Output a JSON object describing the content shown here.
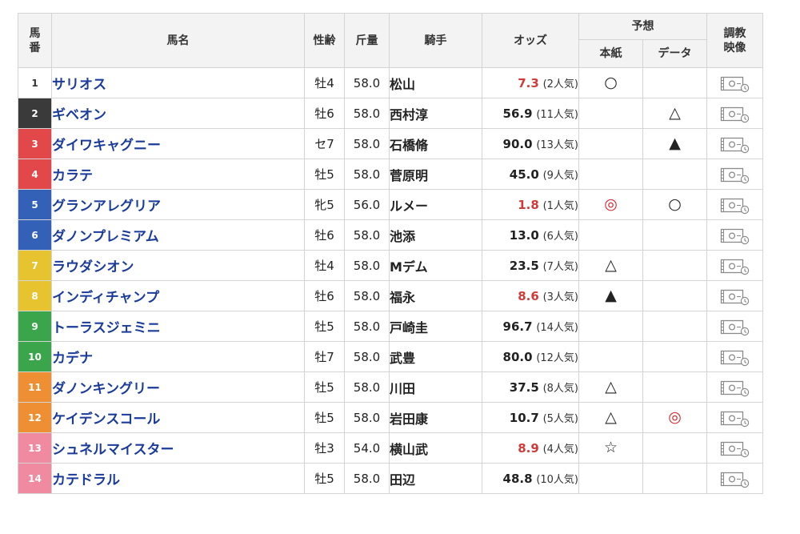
{
  "table": {
    "headers": {
      "number": "馬\n番",
      "horse_name": "馬名",
      "sex_age": "性齢",
      "weight": "斤量",
      "jockey": "騎手",
      "odds": "オッズ",
      "prediction": "予想",
      "prediction_paper": "本紙",
      "prediction_data": "データ",
      "training_video": "調教\n映像"
    },
    "rows": [
      {
        "number": "1",
        "name": "サリオス",
        "sex_age": "牡4",
        "weight": "58.0",
        "jockey": "松山",
        "odds": "7.3",
        "popularity": "(2人気)",
        "favorite": true,
        "mark_paper": "○",
        "mark_data": "",
        "frame_color": "#ffffff",
        "number_color": "#333333"
      },
      {
        "number": "2",
        "name": "ギベオン",
        "sex_age": "牡6",
        "weight": "58.0",
        "jockey": "西村淳",
        "odds": "56.9",
        "popularity": "(11人気)",
        "favorite": false,
        "mark_paper": "",
        "mark_data": "△",
        "frame_color": "#3a3a3a",
        "number_color": "#ffffff"
      },
      {
        "number": "3",
        "name": "ダイワキャグニー",
        "sex_age": "セ7",
        "weight": "58.0",
        "jockey": "石橋脩",
        "odds": "90.0",
        "popularity": "(13人気)",
        "favorite": false,
        "mark_paper": "",
        "mark_data": "▲",
        "frame_color": "#e2474a",
        "number_color": "#ffffff"
      },
      {
        "number": "4",
        "name": "カラテ",
        "sex_age": "牡5",
        "weight": "58.0",
        "jockey": "菅原明",
        "odds": "45.0",
        "popularity": "(9人気)",
        "favorite": false,
        "mark_paper": "",
        "mark_data": "",
        "frame_color": "#e2474a",
        "number_color": "#ffffff"
      },
      {
        "number": "5",
        "name": "グランアレグリア",
        "sex_age": "牝5",
        "weight": "56.0",
        "jockey": "ルメー",
        "odds": "1.8",
        "popularity": "(1人気)",
        "favorite": true,
        "mark_paper": "◎",
        "mark_data": "○",
        "frame_color": "#3461b8",
        "number_color": "#ffffff"
      },
      {
        "number": "6",
        "name": "ダノンプレミアム",
        "sex_age": "牡6",
        "weight": "58.0",
        "jockey": "池添",
        "odds": "13.0",
        "popularity": "(6人気)",
        "favorite": false,
        "mark_paper": "",
        "mark_data": "",
        "frame_color": "#3461b8",
        "number_color": "#ffffff"
      },
      {
        "number": "7",
        "name": "ラウダシオン",
        "sex_age": "牡4",
        "weight": "58.0",
        "jockey": "Mデム",
        "odds": "23.5",
        "popularity": "(7人気)",
        "favorite": false,
        "mark_paper": "△",
        "mark_data": "",
        "frame_color": "#e7c42f",
        "number_color": "#ffffff"
      },
      {
        "number": "8",
        "name": "インディチャンプ",
        "sex_age": "牡6",
        "weight": "58.0",
        "jockey": "福永",
        "odds": "8.6",
        "popularity": "(3人気)",
        "favorite": true,
        "mark_paper": "▲",
        "mark_data": "",
        "frame_color": "#e7c42f",
        "number_color": "#ffffff"
      },
      {
        "number": "9",
        "name": "トーラスジェミニ",
        "sex_age": "牡5",
        "weight": "58.0",
        "jockey": "戸崎圭",
        "odds": "96.7",
        "popularity": "(14人気)",
        "favorite": false,
        "mark_paper": "",
        "mark_data": "",
        "frame_color": "#3ba54b",
        "number_color": "#ffffff"
      },
      {
        "number": "10",
        "name": "カデナ",
        "sex_age": "牡7",
        "weight": "58.0",
        "jockey": "武豊",
        "odds": "80.0",
        "popularity": "(12人気)",
        "favorite": false,
        "mark_paper": "",
        "mark_data": "",
        "frame_color": "#3ba54b",
        "number_color": "#ffffff"
      },
      {
        "number": "11",
        "name": "ダノンキングリー",
        "sex_age": "牡5",
        "weight": "58.0",
        "jockey": "川田",
        "odds": "37.5",
        "popularity": "(8人気)",
        "favorite": false,
        "mark_paper": "△",
        "mark_data": "",
        "frame_color": "#ee8f34",
        "number_color": "#ffffff"
      },
      {
        "number": "12",
        "name": "ケイデンスコール",
        "sex_age": "牡5",
        "weight": "58.0",
        "jockey": "岩田康",
        "odds": "10.7",
        "popularity": "(5人気)",
        "favorite": false,
        "mark_paper": "△",
        "mark_data": "◎",
        "frame_color": "#ee8f34",
        "number_color": "#ffffff"
      },
      {
        "number": "13",
        "name": "シュネルマイスター",
        "sex_age": "牡3",
        "weight": "54.0",
        "jockey": "横山武",
        "odds": "8.9",
        "popularity": "(4人気)",
        "favorite": true,
        "mark_paper": "☆",
        "mark_data": "",
        "frame_color": "#f08aa0",
        "number_color": "#ffffff"
      },
      {
        "number": "14",
        "name": "カテドラル",
        "sex_age": "牡5",
        "weight": "58.0",
        "jockey": "田辺",
        "odds": "48.8",
        "popularity": "(10人気)",
        "favorite": false,
        "mark_paper": "",
        "mark_data": "",
        "frame_color": "#f08aa0",
        "number_color": "#ffffff"
      }
    ]
  },
  "icons": {
    "training_video": "video-camera-icon"
  },
  "colors": {
    "name_link": "#1b3b9b",
    "favorite_odds": "#d23a3a",
    "double_circle_mark": "#d8232a",
    "header_bg": "#f3f3f3",
    "border": "#d4d4d4"
  }
}
